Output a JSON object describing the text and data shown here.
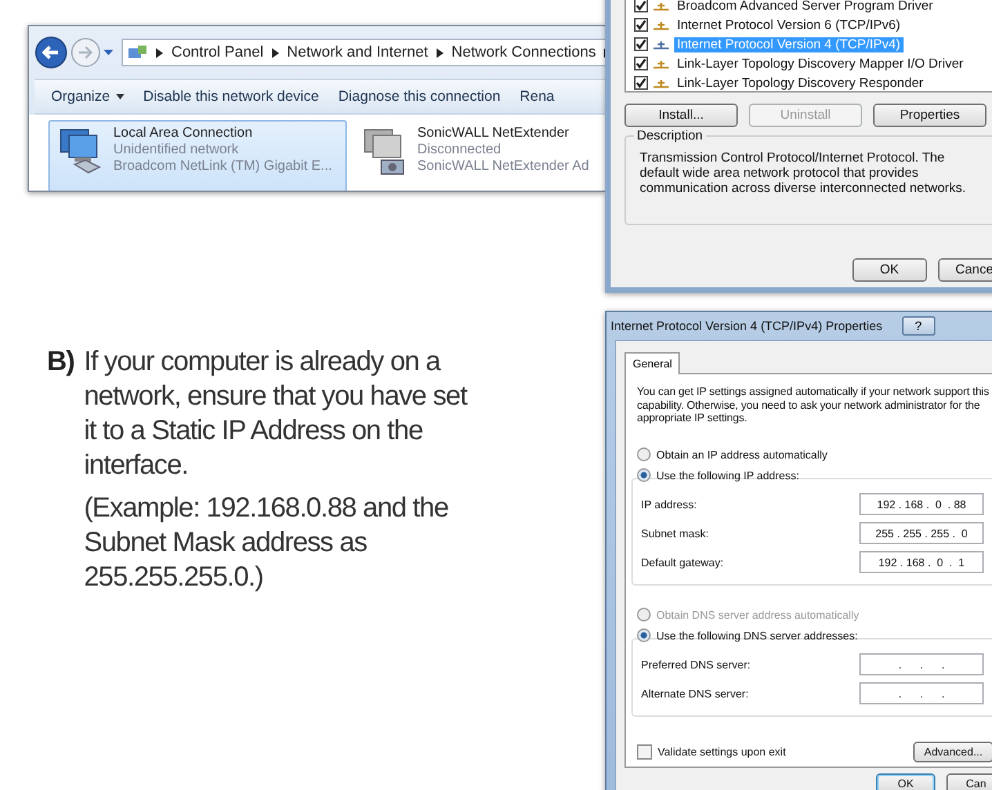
{
  "explorer": {
    "address": [
      "Control Panel",
      "Network and Internet",
      "Network Connections"
    ],
    "toolbar": [
      {
        "label": "Organize",
        "menu": true
      },
      {
        "label": "Disable this network device",
        "menu": false
      },
      {
        "label": "Diagnose this connection",
        "menu": false
      },
      {
        "label": "Rena",
        "menu": false
      }
    ],
    "connections": [
      {
        "name": "Local Area Connection",
        "status": "Unidentified network",
        "adapter": "Broadcom NetLink (TM) Gigabit E...",
        "selected": true,
        "kind": "ethernet"
      },
      {
        "name": "SonicWALL NetExtender",
        "status": "Disconnected",
        "adapter": "SonicWALL NetExtender Ad",
        "selected": false,
        "kind": "dialup"
      }
    ]
  },
  "adapter_properties": {
    "components": [
      {
        "label": "Broadcom Advanced Server Program Driver",
        "checked": true,
        "selected": false
      },
      {
        "label": "Internet Protocol Version 6 (TCP/IPv6)",
        "checked": true,
        "selected": false
      },
      {
        "label": "Internet Protocol Version 4 (TCP/IPv4)",
        "checked": true,
        "selected": true
      },
      {
        "label": "Link-Layer Topology Discovery Mapper I/O Driver",
        "checked": true,
        "selected": false
      },
      {
        "label": "Link-Layer Topology Discovery Responder",
        "checked": true,
        "selected": false
      }
    ],
    "buttons": [
      {
        "label": "Install...",
        "disabled": false
      },
      {
        "label": "Uninstall",
        "disabled": true
      },
      {
        "label": "Properties",
        "disabled": false
      }
    ],
    "description_label": "Description",
    "description": "Transmission Control Protocol/Internet Protocol. The default wide area network protocol that provides communication across diverse interconnected networks.",
    "footer_buttons": [
      "OK",
      "Cance"
    ]
  },
  "ipv4_properties": {
    "title": "Internet Protocol Version 4 (TCP/IPv4) Properties",
    "help": "?",
    "tab": "General",
    "intro": "You can get IP settings assigned automatically if your network support this capability. Otherwise, you need to ask your network administrator for the appropriate IP settings.",
    "ip_options": [
      {
        "label": "Obtain an IP address automatically",
        "selected": false,
        "disabled": false
      },
      {
        "label": "Use the following IP address:",
        "selected": true,
        "disabled": false
      }
    ],
    "ip_fields": [
      {
        "label": "IP address:",
        "value": "192 . 168 .  0  . 88"
      },
      {
        "label": "Subnet mask:",
        "value": "255 . 255 . 255 .  0"
      },
      {
        "label": "Default gateway:",
        "value": "192 . 168 .  0  .  1"
      }
    ],
    "dns_options": [
      {
        "label": "Obtain DNS server address automatically",
        "selected": false,
        "disabled": true
      },
      {
        "label": "Use the following DNS server addresses:",
        "selected": true,
        "disabled": false
      }
    ],
    "dns_fields": [
      {
        "label": "Preferred DNS server:",
        "value": ".      .      ."
      },
      {
        "label": "Alternate DNS server:",
        "value": ".      .      ."
      }
    ],
    "validate": {
      "label": "Validate settings upon exit",
      "checked": false
    },
    "advanced": "Advanced...",
    "footer_buttons": [
      "OK",
      "Can"
    ]
  },
  "instruction": {
    "marker": "B)",
    "text": "If your computer is already on a network, ensure that you have set it to a Static IP Address on the interface.",
    "example": "(Example: 192.168.0.88 and the Subnet Mask address as 255.255.255.0.)"
  }
}
